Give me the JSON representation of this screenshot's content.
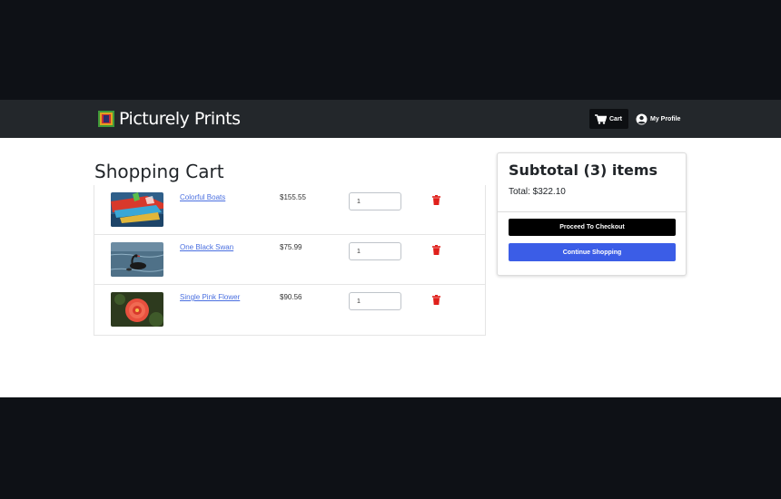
{
  "brand": {
    "name": "Picturely Prints"
  },
  "nav": {
    "cart_label": "Cart",
    "profile_label": "My Profile"
  },
  "cart": {
    "title": "Shopping Cart",
    "items": [
      {
        "name": "Colorful Boats",
        "price": "$155.55",
        "quantity": "1",
        "image": "colorful-boats-photo"
      },
      {
        "name": "One Black Swan",
        "price": "$75.99",
        "quantity": "1",
        "image": "black-swan-photo"
      },
      {
        "name": "Single Pink Flower",
        "price": "$90.56",
        "quantity": "1",
        "image": "pink-flower-photo"
      }
    ]
  },
  "summary": {
    "subtotal": "Subtotal (3) items",
    "total": "Total: $322.10",
    "checkout_label": "Proceed To Checkout",
    "continue_label": "Continue Shopping"
  },
  "colors": {
    "navbar": "#23272b",
    "link": "#4a6fe0",
    "delete": "#e0201b",
    "checkout": "#000000",
    "continue": "#3b5de7",
    "backdrop": "#0e1116"
  },
  "icons": {
    "cart": "cart-icon",
    "profile": "user-circle-icon",
    "delete": "trash-icon"
  }
}
